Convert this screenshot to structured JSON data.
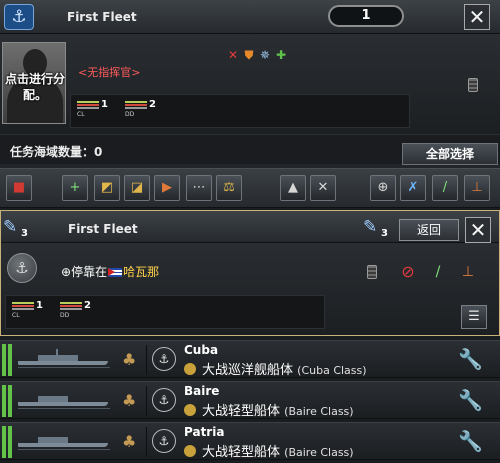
{
  "fleet": {
    "title": "First Fleet",
    "count": "1",
    "close_glyph": "✕",
    "commander_placeholder": "点击进行分配。",
    "no_commander": "<无指挥官>",
    "trait_icons": [
      "crossed-swords-icon",
      "shield-icon",
      "gear-wheel-icon",
      "green-cross-icon"
    ],
    "composition": [
      {
        "type": "CL",
        "count": "1"
      },
      {
        "type": "DD",
        "count": "2"
      }
    ],
    "mission_areas_label": "任务海域数量：0",
    "select_all_label": "全部选择"
  },
  "toolbar": {
    "buttons": [
      {
        "name": "delete-icon",
        "glyph": "🗑"
      },
      {
        "name": "add-taskforce-icon",
        "glyph": "+"
      },
      {
        "name": "split-icon",
        "glyph": "◩"
      },
      {
        "name": "merge-icon",
        "glyph": "◪"
      },
      {
        "name": "transfer-icon",
        "glyph": "▶"
      },
      {
        "name": "formation-icon",
        "glyph": "⋯"
      },
      {
        "name": "balance-icon",
        "glyph": "⚖"
      },
      {
        "name": "mission-up-icon",
        "glyph": "▲"
      },
      {
        "name": "repair-icon",
        "glyph": "✕"
      },
      {
        "name": "add-circle-icon",
        "glyph": "⊕"
      },
      {
        "name": "engage-icon",
        "glyph": "✗"
      },
      {
        "name": "strike-icon",
        "glyph": "/"
      },
      {
        "name": "flag-icon",
        "glyph": "⊥"
      }
    ]
  },
  "taskforce": {
    "badge_count": "3",
    "title": "First Fleet",
    "right_badge_count": "3",
    "return_label": "返回",
    "close_glyph": "✕",
    "docked_prefix": "停靠在",
    "docked_location": "哈瓦那",
    "composition": [
      {
        "type": "CL",
        "count": "1"
      },
      {
        "type": "DD",
        "count": "2"
      }
    ]
  },
  "ships": [
    {
      "name": "Cuba",
      "class": "大战巡洋舰船体",
      "class_en": "(Cuba Class)"
    },
    {
      "name": "Baire",
      "class": "大战轻型船体",
      "class_en": "(Baire Class)"
    },
    {
      "name": "Patria",
      "class": "大战轻型船体",
      "class_en": "(Baire Class)"
    }
  ]
}
